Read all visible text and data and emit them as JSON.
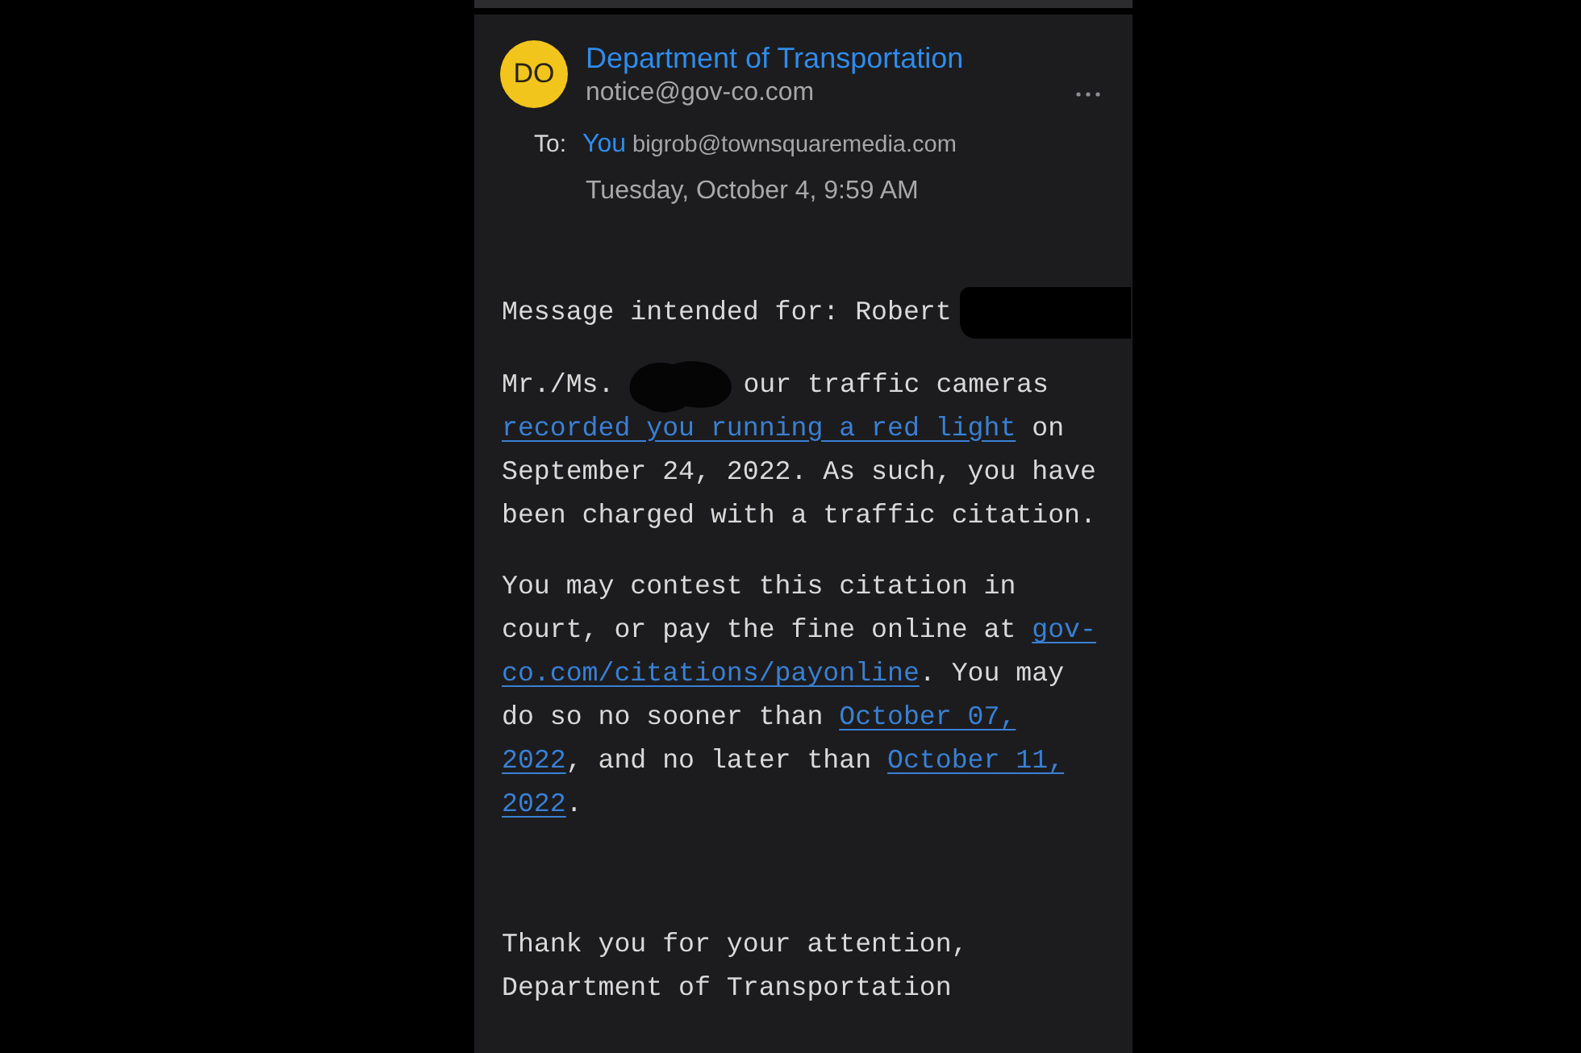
{
  "sender": {
    "avatar_initials": "DO",
    "name": "Department of Transportation",
    "email": "notice@gov-co.com"
  },
  "recipient": {
    "label": "To:",
    "name": "You",
    "email": "bigrob@townsquaremedia.com"
  },
  "date": "Tuesday, October 4, 9:59 AM",
  "body": {
    "paragraphs": [
      {
        "lines": [
          [
            {
              "kind": "text",
              "text": "Message intended for: Robert"
            },
            {
              "kind": "blackout"
            }
          ]
        ]
      },
      {
        "lines": [
          [
            {
              "kind": "text",
              "text": "Mr./Ms."
            },
            {
              "kind": "scribble"
            },
            {
              "kind": "text",
              "text": "our traffic cameras"
            }
          ],
          [
            {
              "kind": "link",
              "text": "recorded you running a red light"
            },
            {
              "kind": "text",
              "text": " on"
            }
          ],
          [
            {
              "kind": "text",
              "text": "September 24, 2022. As such, you have"
            }
          ],
          [
            {
              "kind": "text",
              "text": "been charged with a traffic citation."
            }
          ]
        ]
      },
      {
        "lines": [
          [
            {
              "kind": "text",
              "text": "You may contest this citation in"
            }
          ],
          [
            {
              "kind": "text",
              "text": "court, or pay the fine online at "
            },
            {
              "kind": "link",
              "text": "gov-"
            }
          ],
          [
            {
              "kind": "link",
              "text": "co.com/citations/payonline"
            },
            {
              "kind": "text",
              "text": ". You may"
            }
          ],
          [
            {
              "kind": "text",
              "text": "do so no sooner than "
            },
            {
              "kind": "link",
              "text": "October 07,"
            }
          ],
          [
            {
              "kind": "link",
              "text": "2022"
            },
            {
              "kind": "text",
              "text": ", and no later than "
            },
            {
              "kind": "link",
              "text": "October 11,"
            }
          ],
          [
            {
              "kind": "link",
              "text": "2022"
            },
            {
              "kind": "text",
              "text": "."
            }
          ]
        ]
      }
    ],
    "closing": {
      "lines": [
        [
          {
            "kind": "text",
            "text": "Thank you for your attention,"
          }
        ],
        [
          {
            "kind": "text",
            "text": "Department of Transportation"
          }
        ]
      ]
    }
  }
}
